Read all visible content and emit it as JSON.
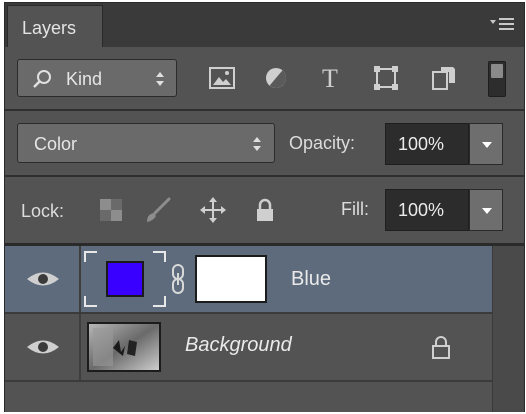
{
  "panel": {
    "tab_label": "Layers",
    "menu_icon": "panel-menu-icon"
  },
  "filter": {
    "kind_label": "Kind",
    "icons": [
      "image-filter-icon",
      "adjustment-filter-icon",
      "type-filter-icon",
      "shape-filter-icon",
      "smart-object-filter-icon"
    ],
    "toggle_state": "off"
  },
  "blend": {
    "mode_label": "Color",
    "opacity_label": "Opacity:",
    "opacity_value": "100%"
  },
  "lock": {
    "label": "Lock:",
    "icons": [
      "lock-transparent-icon",
      "lock-image-icon",
      "lock-position-icon",
      "lock-all-icon"
    ],
    "fill_label": "Fill:",
    "fill_value": "100%"
  },
  "layers": [
    {
      "name": "Blue",
      "selected": true,
      "visible": true,
      "swatch_color": "#3a00ff",
      "mask_color": "#ffffff"
    },
    {
      "name": "Background",
      "selected": false,
      "visible": true,
      "locked": true
    }
  ],
  "colors": {
    "panel_bg": "#535353",
    "selected_row": "#5d6b7d",
    "field_bg": "#6a6a6a",
    "value_bg": "#2c2c2c"
  }
}
